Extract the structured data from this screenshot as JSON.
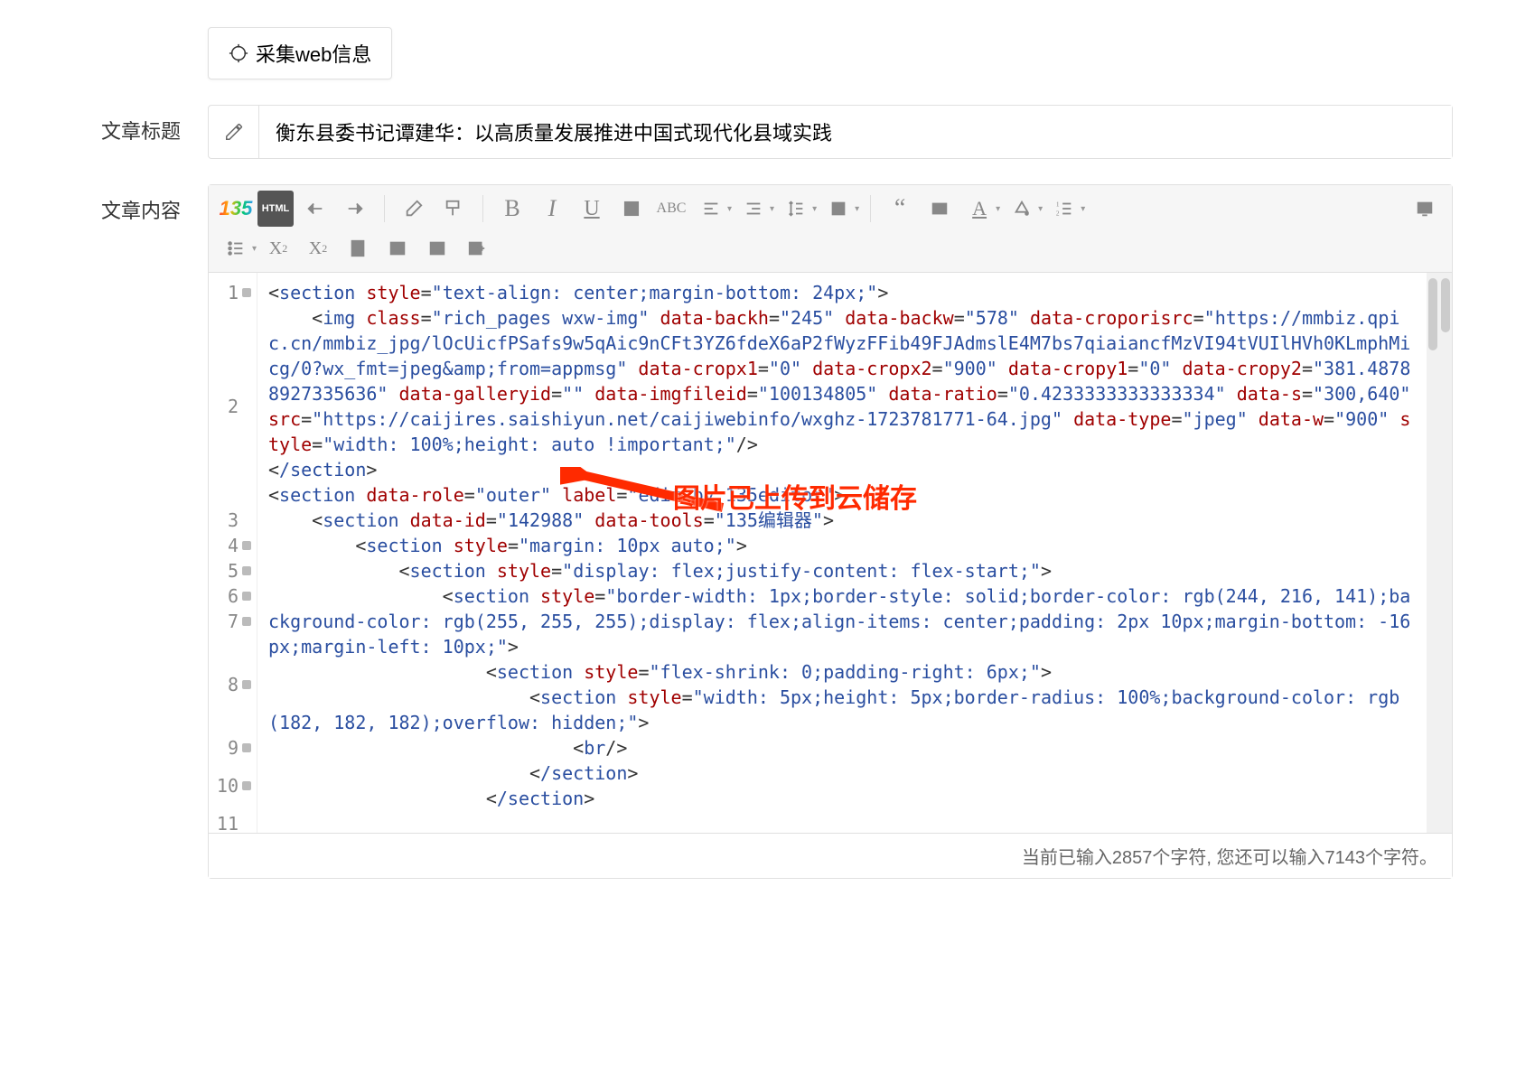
{
  "buttons": {
    "collect_web": "采集web信息"
  },
  "labels": {
    "article_title": "文章标题",
    "article_content": "文章内容"
  },
  "fields": {
    "article_title_value": "衡东县委书记谭建华：以高质量发展推进中国式现代化县域实践"
  },
  "toolbar": {
    "html_label": "HTML",
    "logo_text": "135"
  },
  "annotation": {
    "text": "图片已上传到云储存"
  },
  "status": {
    "chars_entered": 2857,
    "chars_remaining": 7143,
    "text": "当前已输入2857个字符, 您还可以输入7143个字符。"
  },
  "code_lines": {
    "l1": "<section style=\"text-align: center;margin-bottom: 24px;\">",
    "l2": "    <img class=\"rich_pages wxw-img\" data-backh=\"245\" data-backw=\"578\" data-croporisrc=\"https://mmbiz.qpic.cn/mmbiz_jpg/lOcUicfPSafs9w5qAic9nCFt3YZ6fdeX6aP2fWyzFFib49FJAdmslE4M7bs7qiaiancfMzVI94tVUIlHVh0KLmphMicg/0?wx_fmt=jpeg&amp;from=appmsg\" data-cropx1=\"0\" data-cropx2=\"900\" data-cropy1=\"0\" data-cropy2=\"381.48788927335636\" data-galleryid=\"\" data-imgfileid=\"100134805\" data-ratio=\"0.4233333333333334\" data-s=\"300,640\" src=\"https://caijires.saishiyun.net/caijiwebinfo/wxghz-1723781771-64.jpg\" data-type=\"jpeg\" data-w=\"900\" style=\"width: 100%;height: auto !important;\"/>",
    "l3": "</section>",
    "l4": "<section data-role=\"outer\" label=\"edit by 135editor\">",
    "l5": "    <section data-id=\"142988\" data-tools=\"135编辑器\">",
    "l6": "        <section style=\"margin: 10px auto;\">",
    "l7": "            <section style=\"display: flex;justify-content: flex-start;\">",
    "l8": "                <section style=\"border-width: 1px;border-style: solid;border-color: rgb(244, 216, 141);background-color: rgb(255, 255, 255);display: flex;align-items: center;padding: 2px 10px;margin-bottom: -16px;margin-left: 10px;\">",
    "l9": "                    <section style=\"flex-shrink: 0;padding-right: 6px;\">",
    "l10": "                        <section style=\"width: 5px;height: 5px;border-radius: 100%;background-color: rgb(182, 182, 182);overflow: hidden;\">",
    "l11": "                            <br/>",
    "l12": "                        </section>",
    "l13": "                    </section>"
  }
}
